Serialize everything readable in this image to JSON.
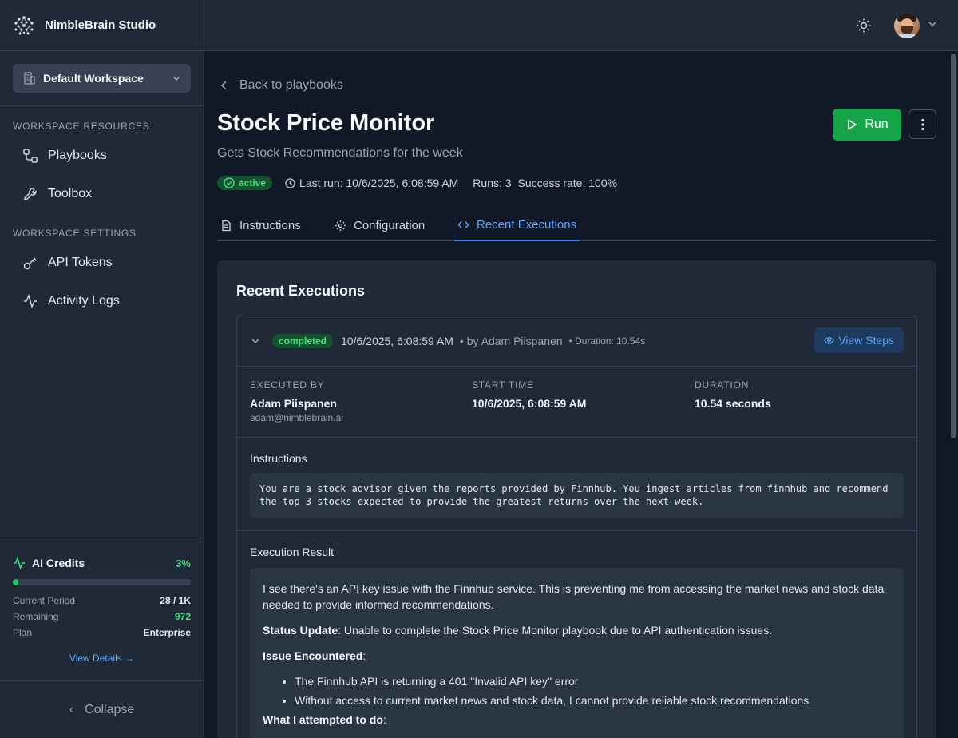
{
  "app": {
    "name": "NimbleBrain Studio"
  },
  "workspace": {
    "selected": "Default Workspace"
  },
  "sidebar": {
    "resources_title": "WORKSPACE RESOURCES",
    "resources": [
      {
        "label": "Playbooks",
        "icon": "workflow-icon"
      },
      {
        "label": "Toolbox",
        "icon": "wrench-icon"
      }
    ],
    "settings_title": "WORKSPACE SETTINGS",
    "settings": [
      {
        "label": "API Tokens",
        "icon": "key-icon"
      },
      {
        "label": "Activity Logs",
        "icon": "activity-icon"
      }
    ]
  },
  "credits": {
    "title": "AI Credits",
    "percent": "3%",
    "fill_fraction": 0.03,
    "current_period_label": "Current Period",
    "current_period_value": "28 / 1K",
    "remaining_label": "Remaining",
    "remaining_value": "972",
    "plan_label": "Plan",
    "plan_value": "Enterprise",
    "view_details": "View Details →"
  },
  "collapse": {
    "label": "Collapse"
  },
  "page": {
    "back": "Back to playbooks",
    "title": "Stock Price Monitor",
    "subtitle": "Gets Stock Recommendations for the week",
    "status": "active",
    "last_run": "Last run: 10/6/2025, 6:08:59 AM",
    "runs": "Runs: 3",
    "success_rate": "Success rate: 100%",
    "run_label": "Run"
  },
  "tabs": [
    {
      "label": "Instructions"
    },
    {
      "label": "Configuration"
    },
    {
      "label": "Recent Executions"
    }
  ],
  "recent": {
    "title": "Recent Executions",
    "execution": {
      "status": "completed",
      "timestamp": "10/6/2025, 6:08:59 AM",
      "by": "• by Adam Piispanen",
      "duration_short": "• Duration: 10.54s",
      "view_steps": "View Steps",
      "executed_by_label": "EXECUTED BY",
      "executed_by_name": "Adam Piispanen",
      "executed_by_email": "adam@nimblebrain.ai",
      "start_time_label": "START TIME",
      "start_time_value": "10/6/2025, 6:08:59 AM",
      "duration_label": "DURATION",
      "duration_value": "10.54 seconds",
      "instructions_label": "Instructions",
      "instructions_text": "You are a stock advisor given the reports provided by Finnhub. You ingest articles from finnhub and recommend\nthe top 3 stocks expected to provide the greatest returns over the next week.",
      "result_label": "Execution Result",
      "result_p1": "I see there's an API key issue with the Finnhub service. This is preventing me from accessing the market news and stock data needed to provide informed recommendations.",
      "result_status_bold": "Status Update",
      "result_status_text": ": Unable to complete the Stock Price Monitor playbook due to API authentication issues.",
      "result_issue_bold": "Issue Encountered",
      "result_issue_colon": ":",
      "result_bullets": [
        "The Finnhub API is returning a 401 \"Invalid API key\" error",
        "Without access to current market news and stock data, I cannot provide reliable stock recommendations"
      ],
      "result_attempt_bold": "What I attempted to do",
      "result_attempt_colon": ":"
    }
  }
}
